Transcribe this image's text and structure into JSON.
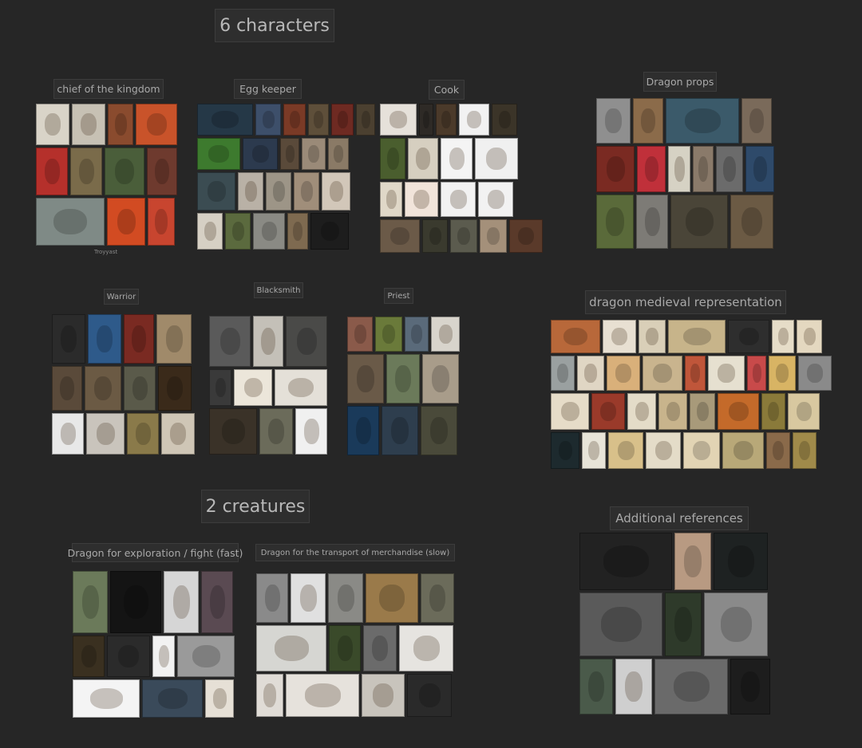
{
  "headings": {
    "characters": "6 characters",
    "creatures": "2 creatures"
  },
  "boards": {
    "chief": "chief of the kingdom",
    "chief_caption": "Troyyast",
    "egg_keeper": "Egg keeper",
    "cook": "Cook",
    "dragon_props": "Dragon props",
    "warrior": "Warrior",
    "blacksmith": "Blacksmith",
    "priest": "Priest",
    "dragon_medieval": "dragon medieval representation",
    "dragon_fast": "Dragon for exploration / fight (fast)",
    "dragon_slow": "Dragon for the transport of merchandise (slow)",
    "additional": "Additional references"
  }
}
